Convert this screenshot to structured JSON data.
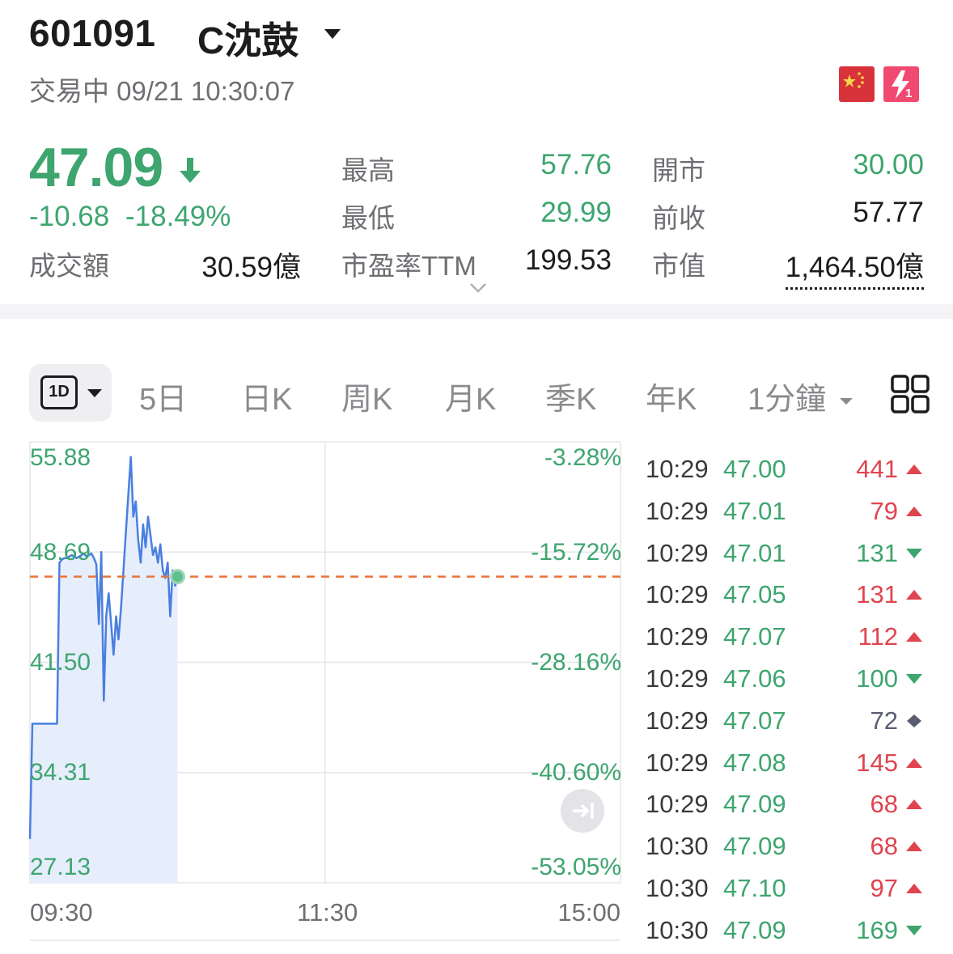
{
  "header": {
    "code": "601091",
    "name": "C沈鼓",
    "status": "交易中 09/21 10:30:07",
    "market_flag": "cn-flag-icon",
    "flash_badge": "flash-l1-icon"
  },
  "quote": {
    "price": "47.09",
    "change": "-10.68",
    "change_pct": "-18.49%",
    "direction": "down",
    "turnover_label": "成交額",
    "turnover_value": "30.59億",
    "high_label": "最高",
    "high_value": "57.76",
    "low_label": "最低",
    "low_value": "29.99",
    "pe_label": "市盈率TTM",
    "pe_value": "199.53",
    "open_label": "開市",
    "open_value": "30.00",
    "prev_close_label": "前收",
    "prev_close_value": "57.77",
    "mcap_label": "市值",
    "mcap_value": "1,464.50億"
  },
  "tabs": {
    "selected": "1D",
    "items": [
      "5日",
      "日K",
      "周K",
      "月K",
      "季K",
      "年K"
    ],
    "interval": "1分鐘"
  },
  "chart": {
    "y_left": [
      "55.88",
      "48.69",
      "41.50",
      "34.31",
      "27.13"
    ],
    "y_right": [
      "-3.28%",
      "-15.72%",
      "-28.16%",
      "-40.60%",
      "-53.05%"
    ],
    "x_labels": [
      "09:30",
      "11:30",
      "15:00"
    ]
  },
  "chart_data": {
    "type": "line",
    "x_range": [
      "09:30",
      "15:00"
    ],
    "ylim": [
      27.13,
      55.88
    ],
    "reference_line": 47.09,
    "series": [
      {
        "x": [
          "09:30",
          "09:31",
          "09:32",
          "09:33",
          "09:34",
          "09:35",
          "09:36",
          "09:37",
          "09:38",
          "09:39",
          "09:40",
          "09:41",
          "09:42",
          "09:43",
          "09:44",
          "09:45",
          "09:46",
          "09:47",
          "09:48",
          "09:49",
          "09:50",
          "09:51",
          "09:52",
          "09:53",
          "09:54",
          "09:55",
          "09:56",
          "09:57",
          "09:58",
          "09:59",
          "10:00",
          "10:01",
          "10:02",
          "10:03",
          "10:04",
          "10:05",
          "10:06",
          "10:07",
          "10:08",
          "10:09",
          "10:10",
          "10:11",
          "10:12",
          "10:13",
          "10:14",
          "10:15",
          "10:16",
          "10:17",
          "10:18",
          "10:19",
          "10:20",
          "10:21",
          "10:22",
          "10:23",
          "10:24",
          "10:25",
          "10:26",
          "10:27",
          "10:28",
          "10:29",
          "10:30"
        ],
        "values": [
          29.99,
          37.5,
          37.5,
          37.5,
          37.5,
          37.5,
          37.5,
          37.5,
          37.5,
          37.5,
          37.5,
          37.5,
          48.0,
          48.2,
          48.3,
          48.3,
          48.4,
          48.5,
          48.4,
          48.3,
          48.4,
          48.5,
          48.6,
          48.4,
          48.5,
          48.6,
          48.3,
          47.9,
          44.0,
          48.7,
          39.0,
          44.5,
          46.0,
          44.0,
          42.0,
          44.5,
          43.0,
          45.0,
          47.5,
          50.0,
          52.5,
          54.9,
          51.0,
          52.0,
          49.5,
          48.0,
          50.5,
          49.0,
          51.0,
          49.8,
          48.5,
          49.0,
          48.0,
          49.2,
          47.5,
          47.0,
          48.0,
          44.5,
          47.5,
          46.5,
          47.09
        ]
      }
    ]
  },
  "trades": [
    {
      "time": "10:29",
      "price": "47.00",
      "volume": "441",
      "dir": "up"
    },
    {
      "time": "10:29",
      "price": "47.01",
      "volume": "79",
      "dir": "up"
    },
    {
      "time": "10:29",
      "price": "47.01",
      "volume": "131",
      "dir": "down"
    },
    {
      "time": "10:29",
      "price": "47.05",
      "volume": "131",
      "dir": "up"
    },
    {
      "time": "10:29",
      "price": "47.07",
      "volume": "112",
      "dir": "up"
    },
    {
      "time": "10:29",
      "price": "47.06",
      "volume": "100",
      "dir": "down"
    },
    {
      "time": "10:29",
      "price": "47.07",
      "volume": "72",
      "dir": "neutral"
    },
    {
      "time": "10:29",
      "price": "47.08",
      "volume": "145",
      "dir": "up"
    },
    {
      "time": "10:29",
      "price": "47.09",
      "volume": "68",
      "dir": "up"
    },
    {
      "time": "10:30",
      "price": "47.09",
      "volume": "68",
      "dir": "up"
    },
    {
      "time": "10:30",
      "price": "47.10",
      "volume": "97",
      "dir": "up"
    },
    {
      "time": "10:30",
      "price": "47.09",
      "volume": "169",
      "dir": "down"
    }
  ],
  "colors": {
    "up": "#e0444e",
    "down": "#3ea56f",
    "line": "#4a7fe0",
    "area": "#e6edfb",
    "ref_line": "#e8743b"
  }
}
